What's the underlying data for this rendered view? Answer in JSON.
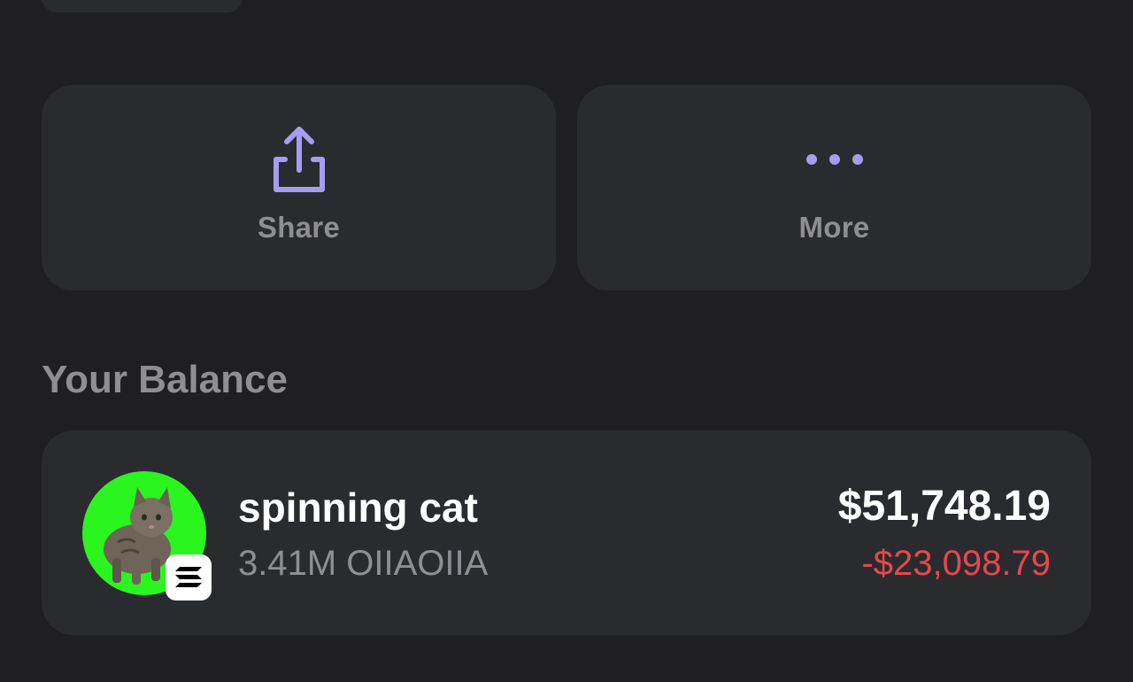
{
  "actions": {
    "share_label": "Share",
    "share_icon": "share-icon",
    "more_label": "More",
    "more_icon": "more-dots-icon",
    "icon_color": "#a99cf0"
  },
  "balance": {
    "section_title": "Your Balance",
    "token": {
      "name": "spinning cat",
      "amount": "3.41M OIIAOIIA",
      "value": "$51,748.19",
      "change": "-$23,098.79",
      "change_color": "#e5484d",
      "avatar_icon": "cat-avatar",
      "avatar_bg": "#2af51e",
      "chain_icon": "solana-icon"
    }
  }
}
